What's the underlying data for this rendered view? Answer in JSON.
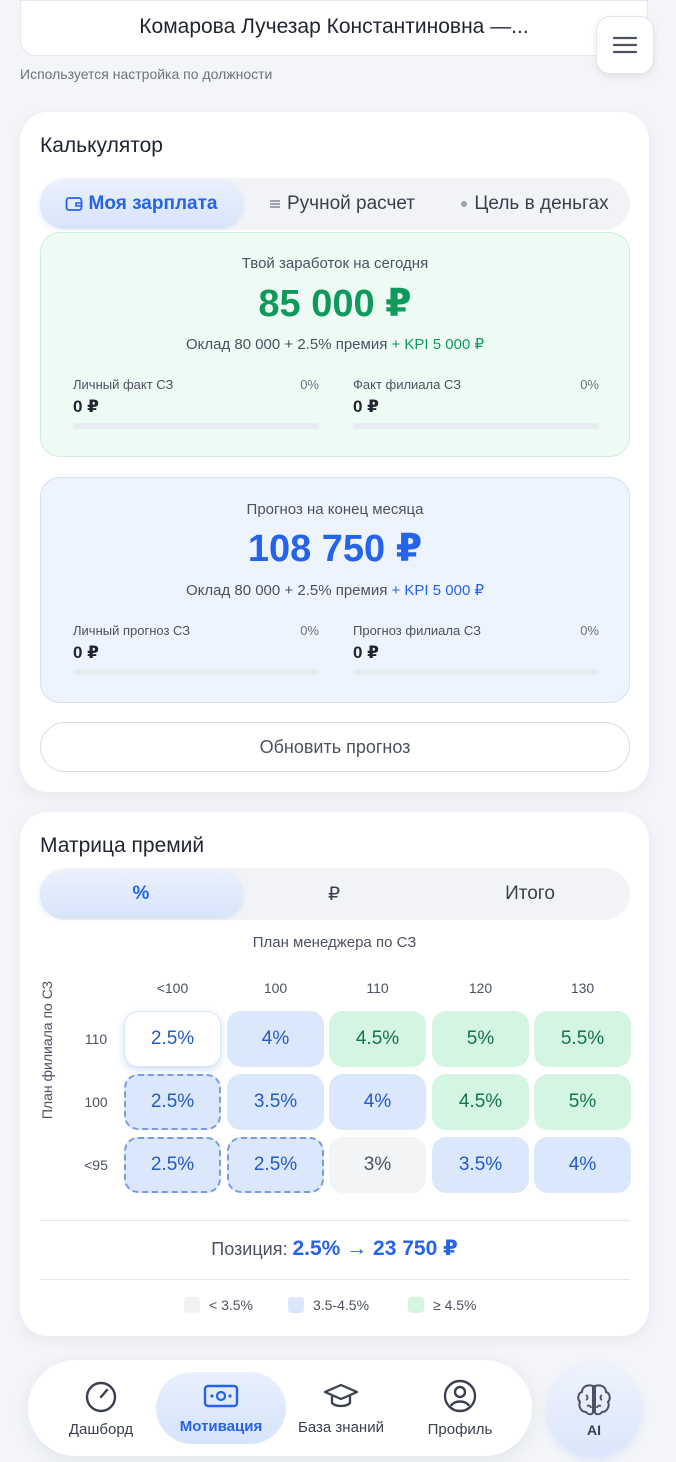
{
  "header": {
    "employee": "Комарова Лучезар Константиновна —...",
    "subtitle": "Используется настройка по должности"
  },
  "calculator": {
    "title": "Калькулятор",
    "tabs": [
      {
        "label": "Моя зарплата",
        "icon": "wallet-icon",
        "active": true
      },
      {
        "label": "Ручной расчет",
        "icon": "sliders-icon",
        "active": false
      },
      {
        "label": "Цель в деньгах",
        "icon": "dot-icon",
        "active": false
      }
    ],
    "today": {
      "caption": "Твой заработок на сегодня",
      "amount": "85 000 ₽",
      "formula": "Оклад 80 000 + 2.5% премия",
      "kpi": "+ KPI 5 000 ₽",
      "personal": {
        "label": "Личный факт СЗ",
        "pct": "0%",
        "value": "0 ₽",
        "progress": 0
      },
      "branch": {
        "label": "Факт филиала СЗ",
        "pct": "0%",
        "value": "0 ₽",
        "progress": 0
      }
    },
    "forecast": {
      "caption": "Прогноз на конец месяца",
      "amount": "108 750 ₽",
      "formula": "Оклад 80 000 + 2.5% премия",
      "kpi": "+ KPI 5 000 ₽",
      "personal": {
        "label": "Личный прогноз СЗ",
        "pct": "0%",
        "value": "0 ₽",
        "progress": 0
      },
      "branch": {
        "label": "Прогноз филиала СЗ",
        "pct": "0%",
        "value": "0 ₽",
        "progress": 0
      }
    },
    "update_button": "Обновить прогноз"
  },
  "matrix": {
    "title": "Матрица премий",
    "tabs": [
      {
        "label": "%",
        "active": true
      },
      {
        "label": "₽",
        "active": false
      },
      {
        "label": "Итого",
        "active": false
      }
    ],
    "x_title": "План менеджера по СЗ",
    "y_title": "План филиала по СЗ",
    "columns": [
      "<100",
      "100",
      "110",
      "120",
      "130"
    ],
    "rows": [
      {
        "label": "110",
        "cells": [
          "2.5%",
          "4%",
          "4.5%",
          "5%",
          "5.5%"
        ],
        "tones": [
          "selected",
          "blue",
          "green",
          "green",
          "green"
        ]
      },
      {
        "label": "100",
        "cells": [
          "2.5%",
          "3.5%",
          "4%",
          "4.5%",
          "5%"
        ],
        "tones": [
          "blue-dashed",
          "blue",
          "blue",
          "green",
          "green"
        ]
      },
      {
        "label": "<95",
        "cells": [
          "2.5%",
          "2.5%",
          "3%",
          "3.5%",
          "4%"
        ],
        "tones": [
          "blue-dashed",
          "blue-dashed",
          "gray",
          "blue",
          "blue"
        ]
      }
    ],
    "position_label": "Позиция:",
    "position_value": "2.5% → 23 750 ₽",
    "legend": [
      {
        "label": "< 3.5%",
        "color": "#f0f1f4"
      },
      {
        "label": "3.5-4.5%",
        "color": "#dbe7fb"
      },
      {
        "label": "≥ 4.5%",
        "color": "#d3f5e2"
      }
    ]
  },
  "nav": {
    "items": [
      {
        "label": "Дашборд",
        "icon": "gauge-icon",
        "active": false
      },
      {
        "label": "Мотивация",
        "icon": "money-icon",
        "active": true
      },
      {
        "label": "База знаний",
        "icon": "graduation-cap-icon",
        "active": false
      },
      {
        "label": "Профиль",
        "icon": "profile-icon",
        "active": false
      }
    ],
    "ai_label": "AI"
  },
  "colors": {
    "accent": "#2563eb",
    "success": "#0f9a5c",
    "today_bg": "#eefbf4",
    "forecast_bg": "#eef4fd"
  }
}
